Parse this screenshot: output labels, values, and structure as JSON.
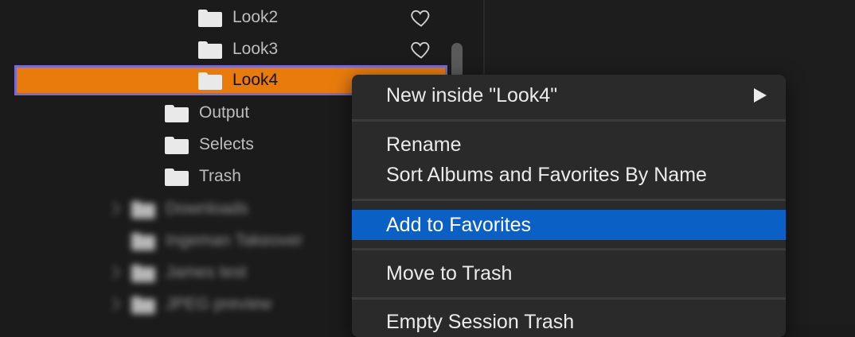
{
  "tree": {
    "items": [
      {
        "label": "Look2"
      },
      {
        "label": "Look3"
      },
      {
        "label": "Look4"
      },
      {
        "label": "Output"
      },
      {
        "label": "Selects"
      },
      {
        "label": "Trash"
      },
      {
        "label": "Downloads"
      },
      {
        "label": "Ingeman Takeover"
      },
      {
        "label": "James test"
      },
      {
        "label": "JPEG preview"
      }
    ]
  },
  "context_menu": {
    "new_inside": "New inside \"Look4\"",
    "rename": "Rename",
    "sort": "Sort Albums and Favorites By Name",
    "add_favorites": "Add to Favorites",
    "move_trash": "Move to Trash",
    "empty_trash": "Empty Session Trash"
  },
  "colors": {
    "selection": "#e97b0d",
    "selection_border": "#7a6bd3",
    "menu_highlight": "#0b60c6"
  },
  "icons": [
    "folder-icon",
    "heart-icon",
    "chevron-right-icon",
    "submenu-arrow-icon"
  ]
}
